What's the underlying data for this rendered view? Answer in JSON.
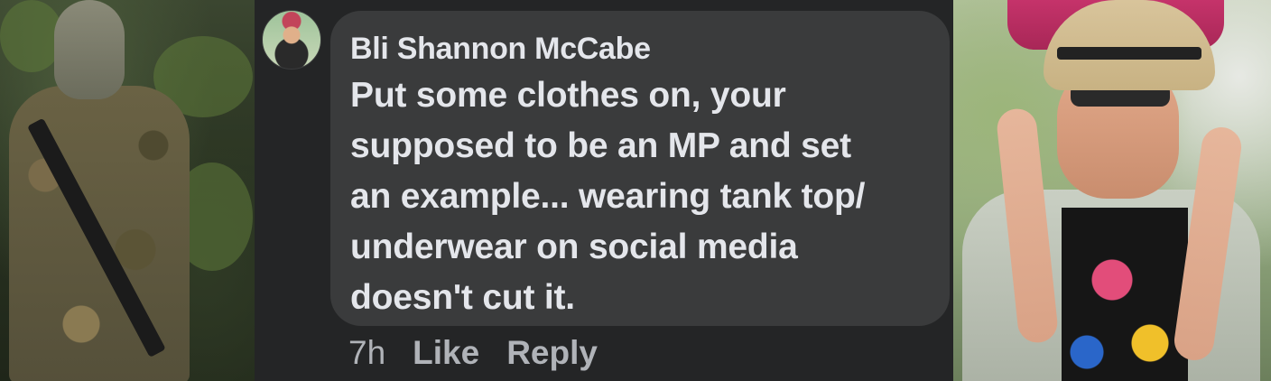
{
  "comment": {
    "author": "Bli Shannon McCabe",
    "text_lines": [
      "Put some clothes on, your",
      "supposed to be an MP and set",
      "an example... wearing tank top/",
      "underwear on social media",
      "doesn't cut it."
    ],
    "time": "7h",
    "like_label": "Like",
    "reply_label": "Reply"
  },
  "colors": {
    "background": "#242526",
    "bubble": "#3a3b3c",
    "primary_text": "#e4e6eb",
    "secondary_text": "#b0b3b8"
  }
}
